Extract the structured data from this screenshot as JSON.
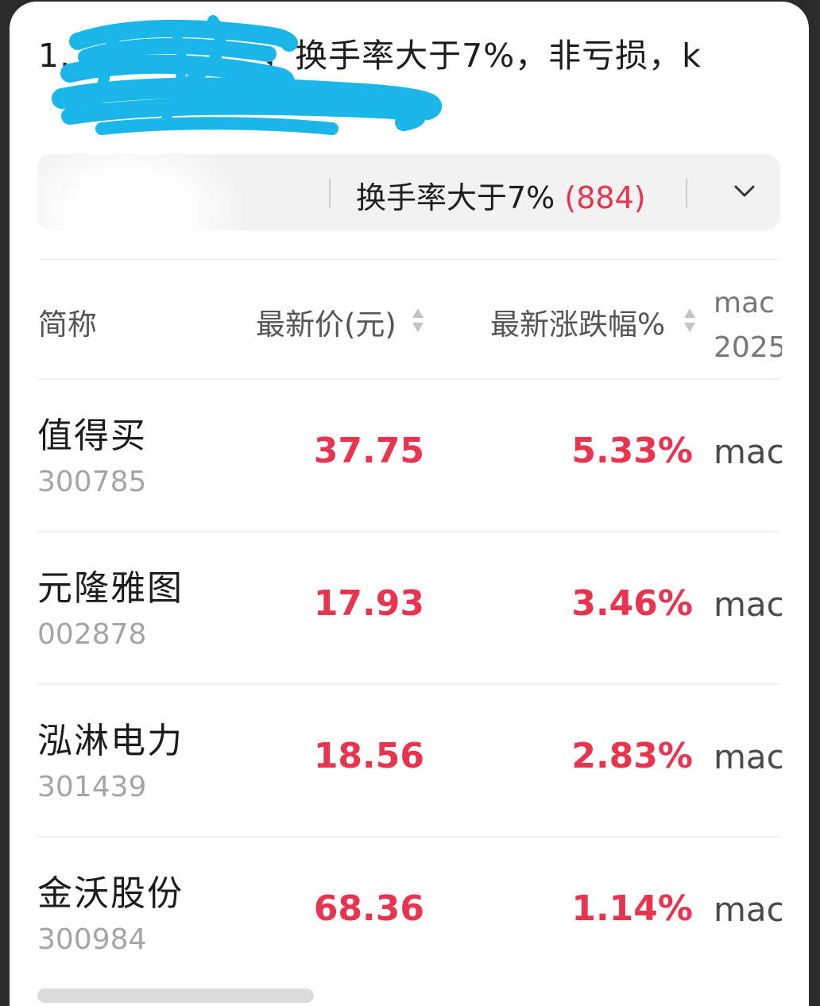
{
  "query": {
    "prefix": "1.",
    "visible_text": "，换手率大于7%，非亏损，k"
  },
  "filter": {
    "faded_condition": "m         60)",
    "condition_label": "换手率大于7%",
    "condition_count": "(884)",
    "expand_icon": "chevron-down-icon"
  },
  "table": {
    "headers": {
      "name": "简称",
      "price": "最新价(元)",
      "change": "最新涨跌幅%",
      "extra_line1": "mac",
      "extra_line2": "2025"
    },
    "rows": [
      {
        "name": "值得买",
        "code": "300785",
        "price": "37.75",
        "change": "5.33%",
        "extra": "mac"
      },
      {
        "name": "元隆雅图",
        "code": "002878",
        "price": "17.93",
        "change": "3.46%",
        "extra": "mac"
      },
      {
        "name": "泓淋电力",
        "code": "301439",
        "price": "18.56",
        "change": "2.83%",
        "extra": "mac"
      },
      {
        "name": "金沃股份",
        "code": "300984",
        "price": "68.36",
        "change": "1.14%",
        "extra": "mac"
      }
    ]
  },
  "colors": {
    "up": "#e8344f",
    "scribble": "#1ab6ea"
  }
}
